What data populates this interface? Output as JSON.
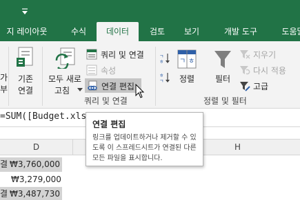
{
  "colors": {
    "accent": "#217346",
    "ribbon_bg": "#f3f3f3",
    "selection": "#d3d3d3"
  },
  "tabs": [
    {
      "label": "지 레이아웃",
      "active": false
    },
    {
      "label": "수식",
      "active": false
    },
    {
      "label": "데이터",
      "active": true
    },
    {
      "label": "검토",
      "active": false
    },
    {
      "label": "보기",
      "active": false
    },
    {
      "label": "개발 도구",
      "active": false
    },
    {
      "label": "도움말",
      "active": false
    }
  ],
  "ribbon": {
    "partial_1": "가",
    "partial_2": "부",
    "existing_connections": [
      "기존",
      "연결"
    ],
    "refresh_all": [
      "모두 새로",
      "고침"
    ],
    "queries_connections": "쿼리 및 연결",
    "properties": "속성",
    "edit_links": "연결 편집",
    "sort_label": "정렬",
    "filter_label": "필터",
    "clear": "지우기",
    "reapply": "다시 적용",
    "advanced": "고급",
    "group_queries": "쿼리 및 연결",
    "group_sort_filter": "정렬 및 필터"
  },
  "formula_bar": {
    "text": "=SUM([Budget.xlsx"
  },
  "columns": {
    "D": "D",
    "H": "H"
  },
  "rows": [
    {
      "row_suffix": "결",
      "value": "₩3,760,000",
      "selected": true
    },
    {
      "row_suffix": "",
      "value": "₩3,279,000",
      "selected": false
    },
    {
      "row_suffix": "결",
      "value": "₩3,487,730",
      "selected": true
    }
  ],
  "tooltip": {
    "title": "연결 편집",
    "description": "링크를 업데이트하거나 제거할 수 있도록 이 스프레드시트가 연결된 다른 모든 파일을 표시합니다."
  }
}
